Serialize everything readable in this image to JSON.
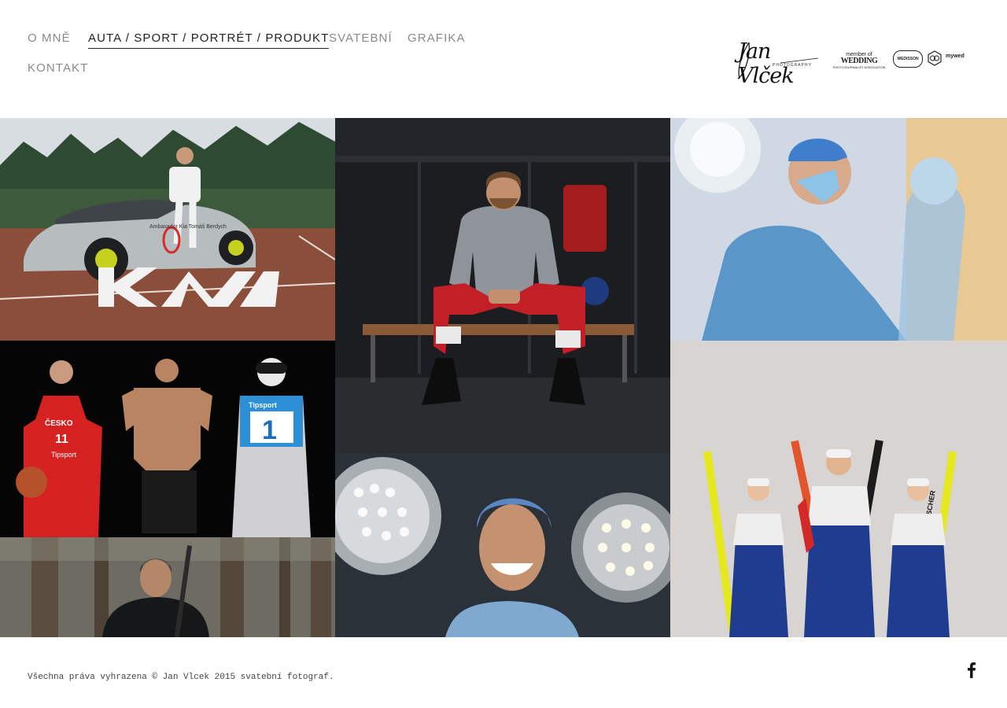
{
  "nav": {
    "items": [
      {
        "label": "O MNĚ"
      },
      {
        "label": "AUTA / SPORT / PORTRÉT / PRODUKT"
      },
      {
        "label": "SVATEBNÍ"
      },
      {
        "label": "GRAFIKA"
      },
      {
        "label": "KONTAKT"
      }
    ],
    "active": "AUTA / SPORT / PORTRÉT / PRODUKT"
  },
  "logos": {
    "signature": "Jan Vlček",
    "signature_sub": "PHOTOGRAPHY",
    "badge_member": "member of",
    "badge_wedding": "WEDDING",
    "badge_wedding_sub": "PHOTOJOURNALIST ASSOCIATION",
    "badge_wedisson": "WEDISSON",
    "badge_mywed": "mywed"
  },
  "gallery": {
    "tiles": [
      {
        "name": "car-tennis-photo",
        "caption_text": "Ambasador Kia Tomáš Berdych"
      },
      {
        "name": "hockey-player-photo"
      },
      {
        "name": "surgeon-photo"
      },
      {
        "name": "athletes-trio-photo",
        "jersey_text": "ČESKO",
        "jersey_number": "11",
        "bib_number": "1",
        "sponsor": "Tipsport"
      },
      {
        "name": "skiers-trio-photo",
        "ski_brand": "FISCHER"
      },
      {
        "name": "surgeon-portrait-photo"
      },
      {
        "name": "forest-portrait-photo"
      }
    ]
  },
  "colors": {
    "nav_inactive": "#8a8a8a",
    "nav_active": "#222222"
  },
  "footer": {
    "copyright": "Všechna práva vyhrazena © Jan Vlcek 2015 svatební fotograf."
  },
  "social": {
    "facebook_icon": "facebook-icon"
  }
}
